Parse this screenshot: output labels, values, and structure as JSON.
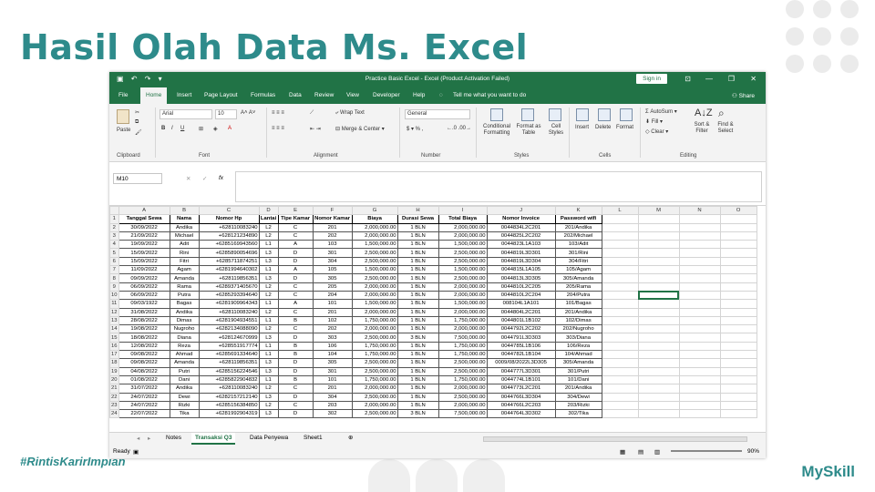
{
  "slide": {
    "title": "Hasil Olah Data Ms. Excel",
    "hashtag": "#RintisKarirImpian",
    "brand": "MySkill"
  },
  "excel": {
    "window_title": "Practice Basic Excel  -  Excel (Product Activation Failed)",
    "sign_in": "Sign in",
    "share": "Share",
    "tell_me": "Tell me what you want to do",
    "menu": [
      "File",
      "Home",
      "Insert",
      "Page Layout",
      "Formulas",
      "Data",
      "Review",
      "View",
      "Developer",
      "Help"
    ],
    "ribbon": {
      "paste": "Paste",
      "clipboard": "Clipboard",
      "font_name": "Arial",
      "font_size": "10",
      "font": "Font",
      "wrap_text": "Wrap Text",
      "merge_center": "Merge & Center",
      "alignment": "Alignment",
      "number_format": "General",
      "number": "Number",
      "cond_format": "Conditional Formatting",
      "format_table": "Format as Table",
      "cell_styles": "Cell Styles",
      "styles": "Styles",
      "insert": "Insert",
      "delete": "Delete",
      "format": "Format",
      "cells": "Cells",
      "autosum": "AutoSum",
      "fill": "Fill",
      "clear": "Clear",
      "sort_filter": "Sort & Filter",
      "find_select": "Find & Select",
      "editing": "Editing"
    },
    "name_box": "M10",
    "fx": "fx",
    "columns": [
      "A",
      "B",
      "C",
      "D",
      "E",
      "F",
      "G",
      "H",
      "I",
      "J",
      "K",
      "L",
      "M",
      "N",
      "O"
    ],
    "headers": [
      "Tanggal Sewa",
      "Nama",
      "Nomor Hp",
      "Lantai",
      "Tipe Kamar",
      "Nomor Kamar",
      "Biaya",
      "Durasi Sewa",
      "Total Biaya",
      "Nomor Invoice",
      "Password wifi"
    ],
    "rows": [
      [
        "30/09/2022",
        "Andika",
        "+628110083240",
        "L2",
        "C",
        "201",
        "2,000,000.00",
        "1 BLN",
        "2,000,000.00",
        "0044834L2C201",
        "201/Andika"
      ],
      [
        "21/09/2022",
        "Michael",
        "+628121234890",
        "L2",
        "C",
        "202",
        "2,000,000.00",
        "1 BLN",
        "2,000,000.00",
        "0044825L2C202",
        "202/Michael"
      ],
      [
        "19/09/2022",
        "Adit",
        "+6285169943560",
        "L1",
        "A",
        "103",
        "1,500,000.00",
        "1 BLN",
        "1,500,000.00",
        "0044823L1A103",
        "103/Adit"
      ],
      [
        "15/09/2022",
        "Rini",
        "+6285890054696",
        "L3",
        "D",
        "301",
        "2,500,000.00",
        "1 BLN",
        "2,500,000.00",
        "0044819L3D301",
        "301/Rini"
      ],
      [
        "15/09/2022",
        "Fitri",
        "+6285711874251",
        "L3",
        "D",
        "304",
        "2,500,000.00",
        "1 BLN",
        "2,500,000.00",
        "0044819L3D304",
        "304/Fitri"
      ],
      [
        "11/09/2022",
        "Agam",
        "+6281994640302",
        "L1",
        "A",
        "105",
        "1,500,000.00",
        "1 BLN",
        "1,500,000.00",
        "0044815L1A105",
        "105/Agam"
      ],
      [
        "09/09/2022",
        "Amanda",
        "+628119856351",
        "L3",
        "D",
        "305",
        "2,500,000.00",
        "1 BLN",
        "2,500,000.00",
        "0044813L3D305",
        "305/Amanda"
      ],
      [
        "06/09/2022",
        "Rama",
        "+6289371405670",
        "L2",
        "C",
        "205",
        "2,000,000.00",
        "1 BLN",
        "2,000,000.00",
        "0044810L2C205",
        "205/Rama"
      ],
      [
        "06/09/2022",
        "Putra",
        "+6285293394640",
        "L2",
        "C",
        "204",
        "2,000,000.00",
        "1 BLN",
        "2,000,000.00",
        "0044810L2C204",
        "204/Putra"
      ],
      [
        "09/03/1922",
        "Bagas",
        "+6281909964343",
        "L1",
        "A",
        "101",
        "1,500,000.00",
        "1 BLN",
        "1,500,000.00",
        "008104L1A101",
        "101/Bagas"
      ],
      [
        "31/08/2022",
        "Andika",
        "+628110083240",
        "L2",
        "C",
        "201",
        "2,000,000.00",
        "1 BLN",
        "2,000,000.00",
        "0044804L2C201",
        "201/Andika"
      ],
      [
        "28/08/2022",
        "Dimas",
        "+6281904934551",
        "L1",
        "B",
        "102",
        "1,750,000.00",
        "1 BLN",
        "1,750,000.00",
        "0044801L1B102",
        "102/Dimas"
      ],
      [
        "19/08/2022",
        "Nugroho",
        "+6282134088090",
        "L2",
        "C",
        "202",
        "2,000,000.00",
        "1 BLN",
        "2,000,000.00",
        "0044792L2C202",
        "202/Nugroho"
      ],
      [
        "18/08/2022",
        "Diana",
        "+628124670999",
        "L3",
        "D",
        "303",
        "2,500,000.00",
        "3 BLN",
        "7,500,000.00",
        "0044791L3D303",
        "303/Diana"
      ],
      [
        "12/08/2022",
        "Reza",
        "+628551917774",
        "L1",
        "B",
        "106",
        "1,750,000.00",
        "1 BLN",
        "1,750,000.00",
        "0044785L1B106",
        "106/Reza"
      ],
      [
        "09/08/2022",
        "Ahmad",
        "+6285691334640",
        "L1",
        "B",
        "104",
        "1,750,000.00",
        "1 BLN",
        "1,750,000.00",
        "0044782L1B104",
        "104/Ahmad"
      ],
      [
        "09/08/2022",
        "Amanda",
        "+628119856351",
        "L3",
        "D",
        "305",
        "2,500,000.00",
        "1 BLN",
        "2,500,000.00",
        "0009/08/2022L3D305",
        "305/Amanda"
      ],
      [
        "04/08/2022",
        "Putri",
        "+6285156224546",
        "L3",
        "D",
        "301",
        "2,500,000.00",
        "1 BLN",
        "2,500,000.00",
        "0044777L3D301",
        "301/Putri"
      ],
      [
        "01/08/2022",
        "Dani",
        "+6285822904832",
        "L1",
        "B",
        "101",
        "1,750,000.00",
        "1 BLN",
        "1,750,000.00",
        "0044774L1B101",
        "101/Dani"
      ],
      [
        "31/07/2022",
        "Andika",
        "+628110083240",
        "L2",
        "C",
        "201",
        "2,000,000.00",
        "1 BLN",
        "2,000,000.00",
        "0044773L2C201",
        "201/Andika"
      ],
      [
        "24/07/2022",
        "Dewi",
        "+6282157212140",
        "L3",
        "D",
        "304",
        "2,500,000.00",
        "1 BLN",
        "2,500,000.00",
        "0044766L3D304",
        "304/Dewi"
      ],
      [
        "24/07/2022",
        "Rizki",
        "+6285156384850",
        "L2",
        "C",
        "203",
        "2,000,000.00",
        "1 BLN",
        "2,000,000.00",
        "0044766L2C203",
        "203/Rizki"
      ],
      [
        "22/07/2022",
        "Tika",
        "+6281992904319",
        "L3",
        "D",
        "302",
        "2,500,000.00",
        "3 BLN",
        "7,500,000.00",
        "0044764L3D302",
        "302/Tika"
      ]
    ],
    "sheet_tabs": [
      "Notes",
      "Transaksi Q3",
      "Data Penyewa",
      "Sheet1"
    ],
    "active_tab": "Transaksi Q3",
    "status": "Ready",
    "zoom": "90%"
  }
}
